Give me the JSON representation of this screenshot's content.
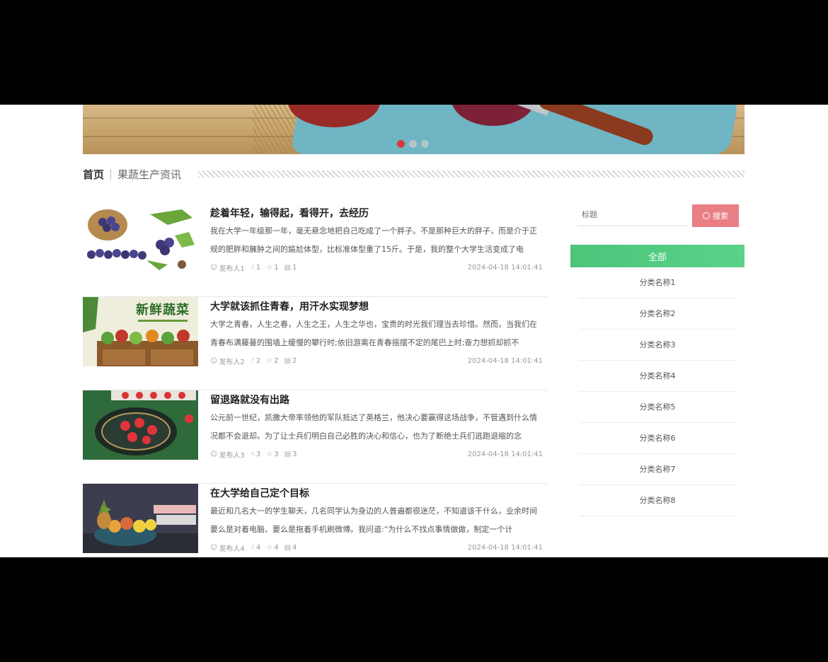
{
  "breadcrumb": {
    "home": "首页",
    "current": "果蔬生产资讯"
  },
  "banner": {
    "slides": 3,
    "active_slide": 1
  },
  "colors": {
    "accent_red": "#d83a3a",
    "search_button": "#ea7e85",
    "category_header": "#4cc47a"
  },
  "articles": [
    {
      "title": "趁着年轻，输得起，看得开，去经历",
      "summary": "我在大学一年级那一年，毫无悬念地把自己吃成了一个胖子。不是那种巨大的胖子，而是介于正规的肥胖和臃肿之间的尴尬体型，比标准体型重了15斤。于是，我的整个大学生活变成了电",
      "author": "发布人1",
      "likes": "1",
      "favorites": "1",
      "comments": "1",
      "date": "2024-04-18 14:01:41",
      "image": "grapes"
    },
    {
      "title": "大学就该抓住青春，用汗水实现梦想",
      "summary": "大学之青春，人生之春，人生之王，人生之华也，宝贵的时光我们理当去珍惜。然而，当我们在青春布满藤蔓的围墙上缓慢的攀行时;依旧游离在青春摇摆不定的尾巴上时;奋力想抓却抓不",
      "author": "发布人2",
      "likes": "2",
      "favorites": "2",
      "comments": "2",
      "date": "2024-04-18 14:01:41",
      "image": "vegetables",
      "image_text": "新鲜蔬菜"
    },
    {
      "title": "留退路就没有出路",
      "summary": "公元前一世纪，凯撒大帝率领他的军队抵达了英格兰，他决心要赢得这场战争，不管遇到什么情况都不会退却。为了让士兵们明白自己必胜的决心和信心，也为了断绝士兵们逃跑退缩的念",
      "author": "发布人3",
      "likes": "3",
      "favorites": "3",
      "comments": "3",
      "date": "2024-04-18 14:01:41",
      "image": "strawberries"
    },
    {
      "title": "在大学给自己定个目标",
      "summary": "最近和几名大一的学生聊天，几名同学认为身边的人普遍都很迷茫，不知道该干什么，业余时间要么是对着电脑、要么是拖着手机刷微博。我问道:“为什么不找点事情做做，制定一个计",
      "author": "发布人4",
      "likes": "4",
      "favorites": "4",
      "comments": "4",
      "date": "2024-04-18 14:01:41",
      "image": "fruit-bowl"
    }
  ],
  "sidebar": {
    "search_placeholder": "标题",
    "search_button": "搜索",
    "category_header": "全部",
    "categories": [
      "分类名称1",
      "分类名称2",
      "分类名称3",
      "分类名称4",
      "分类名称5",
      "分类名称6",
      "分类名称7",
      "分类名称8"
    ]
  }
}
